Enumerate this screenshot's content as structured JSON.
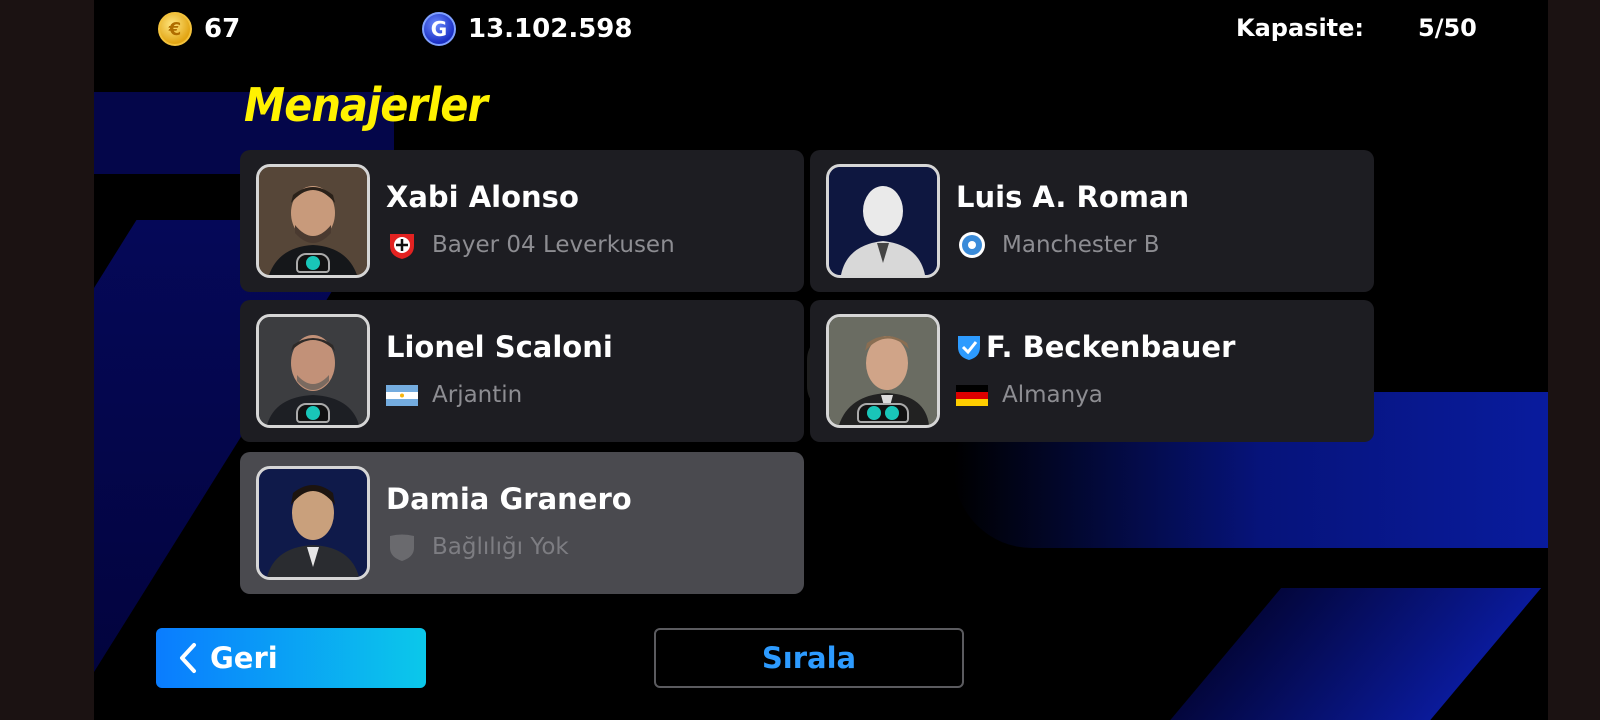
{
  "topbar": {
    "coins": "67",
    "gp": "13.102.598",
    "capacity_label": "Kapasite:",
    "capacity_value": "5/50"
  },
  "page": {
    "title": "Menajerler"
  },
  "managers": [
    {
      "name": "Xabi Alonso",
      "club": "Bayer 04 Leverkusen",
      "club_icon": "bayer-leverkusen-crest-icon",
      "badges": 1,
      "verified": false,
      "selected": false
    },
    {
      "name": "Luis A. Roman",
      "club": "Manchester B",
      "club_icon": "manchester-b-crest-icon",
      "badges": 0,
      "verified": false,
      "selected": false
    },
    {
      "name": "Lionel Scaloni",
      "club": "Arjantin",
      "club_icon": "argentina-flag-icon",
      "badges": 1,
      "verified": false,
      "selected": false
    },
    {
      "name": "F. Beckenbauer",
      "club": "Almanya",
      "club_icon": "germany-flag-icon",
      "badges": 2,
      "verified": true,
      "selected": false
    },
    {
      "name": "Damia Granero",
      "club": "Bağlılığı Yok",
      "club_icon": "no-affiliation-shield-icon",
      "badges": 0,
      "verified": false,
      "selected": true
    }
  ],
  "buttons": {
    "back": "Geri",
    "sort": "Sırala"
  },
  "colors": {
    "title": "#fff200",
    "back_gradient_start": "#0a7cff",
    "back_gradient_end": "#0bc8ea",
    "sort_text": "#2d9bff"
  }
}
